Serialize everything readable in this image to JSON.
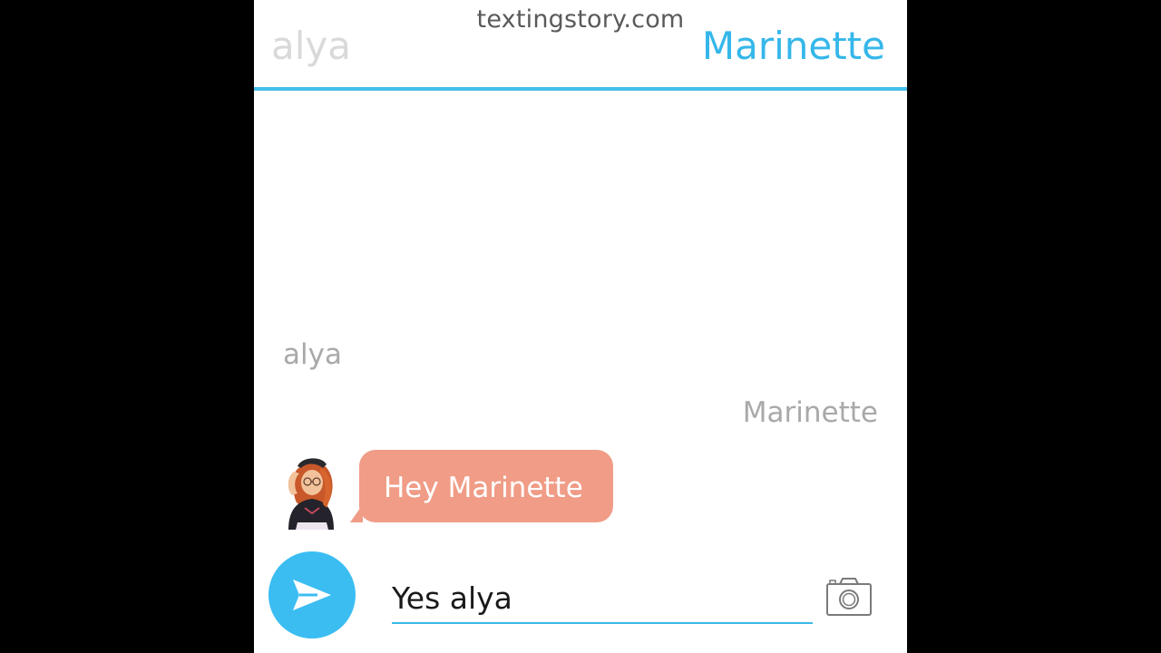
{
  "watermark": "textingstory.com",
  "header": {
    "left_contact": "alya",
    "right_contact": "Marinette"
  },
  "conversation": {
    "sender_left": "alya",
    "sender_right": "Marinette",
    "messages": [
      {
        "from": "alya",
        "text": "Hey Marinette"
      }
    ]
  },
  "composer": {
    "input_value": "Yes alya",
    "send_icon": "send-icon",
    "camera_icon": "camera-icon"
  },
  "colors": {
    "accent": "#35b7ea",
    "bubble_left": "#f09c86",
    "inactive_tab": "#d9d9d9",
    "label_gray": "#a9a9a9"
  }
}
